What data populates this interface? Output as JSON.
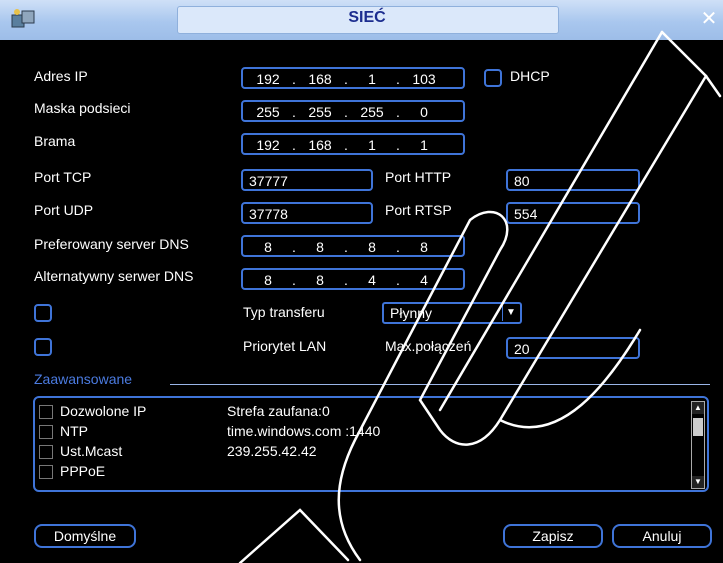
{
  "window": {
    "title": "SIEĆ",
    "close_icon": "close-icon"
  },
  "labels": {
    "ip": "Adres IP",
    "mask": "Maska podsieci",
    "gateway": "Brama",
    "tcp": "Port TCP",
    "udp": "Port UDP",
    "dns1": "Preferowany server DNS",
    "dns2": "Alternatywny serwer DNS",
    "http": "Port HTTP",
    "rtsp": "Port RTSP",
    "dhcp": "DHCP",
    "transfer": "Typ transferu",
    "lan": "Priorytet LAN",
    "maxconn": "Max.połączeń"
  },
  "values": {
    "ip": [
      "192",
      "168",
      "1",
      "103"
    ],
    "mask": [
      "255",
      "255",
      "255",
      "0"
    ],
    "gateway": [
      "192",
      "168",
      "1",
      "1"
    ],
    "dns1": [
      "8",
      "8",
      "8",
      "8"
    ],
    "dns2": [
      "8",
      "8",
      "4",
      "4"
    ],
    "tcp": "37777",
    "udp": "37778",
    "http": "80",
    "rtsp": "554",
    "transfer": "Płynny",
    "maxconn": "20"
  },
  "advanced": {
    "title": "Zaawansowane",
    "rows": [
      {
        "name": "Dozwolone IP",
        "value": "Strefa zaufana:0"
      },
      {
        "name": "NTP",
        "value": "time.windows.com :1440"
      },
      {
        "name": "Ust.Mcast",
        "value": "239.255.42.42"
      },
      {
        "name": "PPPoE",
        "value": ""
      }
    ]
  },
  "buttons": {
    "default": "Domyślne",
    "save": "Zapisz",
    "cancel": "Anuluj"
  },
  "colors": {
    "accent": "#3f74d8",
    "title_text": "#1c2d8f"
  }
}
